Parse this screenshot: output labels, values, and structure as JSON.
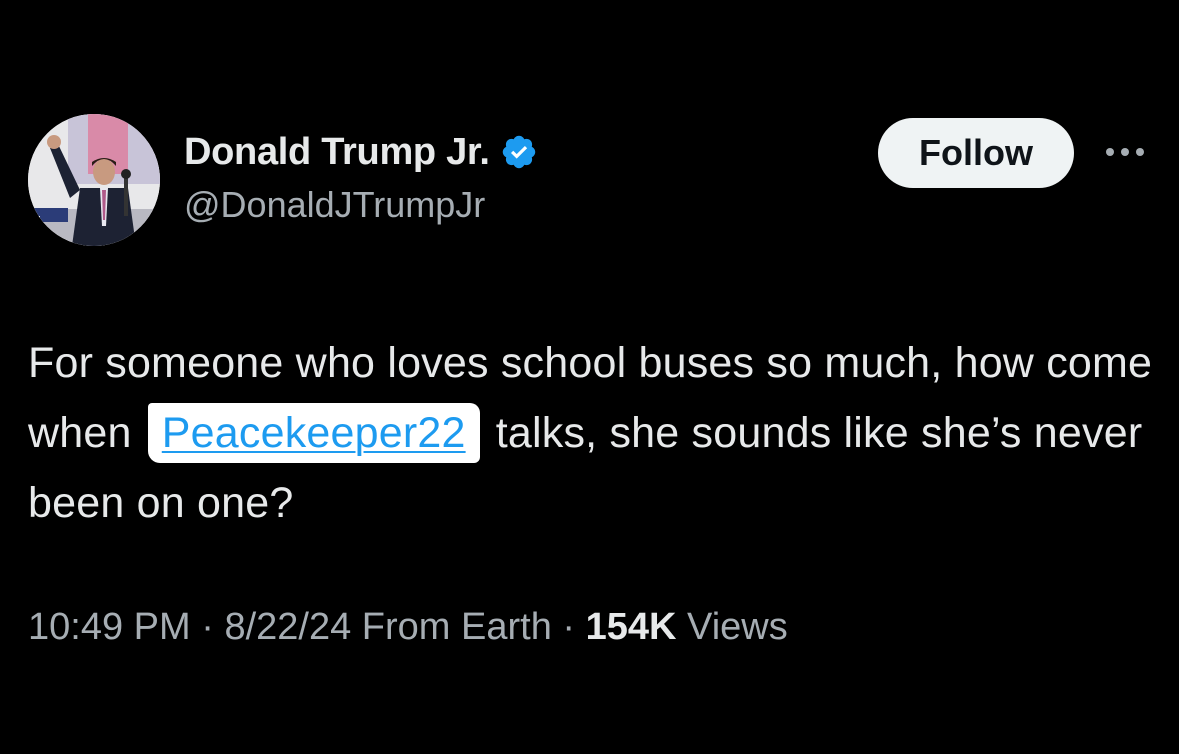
{
  "tweet": {
    "display_name": "Donald Trump Jr.",
    "handle": "@DonaldJTrumpJr",
    "verified_icon": "verified-badge-icon",
    "follow_label": "Follow",
    "more_icon": "more-options-icon",
    "text_part1": "For someone who loves school buses so much, how come when",
    "mention": "Peacekeeper22",
    "text_part2": "talks, she sounds like she’s never been on one?",
    "time": "10:49 PM",
    "separator": "·",
    "date": "8/22/24",
    "source": "From Earth",
    "views_count": "154K",
    "views_label": "Views"
  },
  "colors": {
    "background": "#000000",
    "text": "#e7e9ea",
    "secondary_text": "#a6adb3",
    "link": "#1d9bf0",
    "verified": "#1d9bf0",
    "follow_bg": "#eff3f4"
  }
}
